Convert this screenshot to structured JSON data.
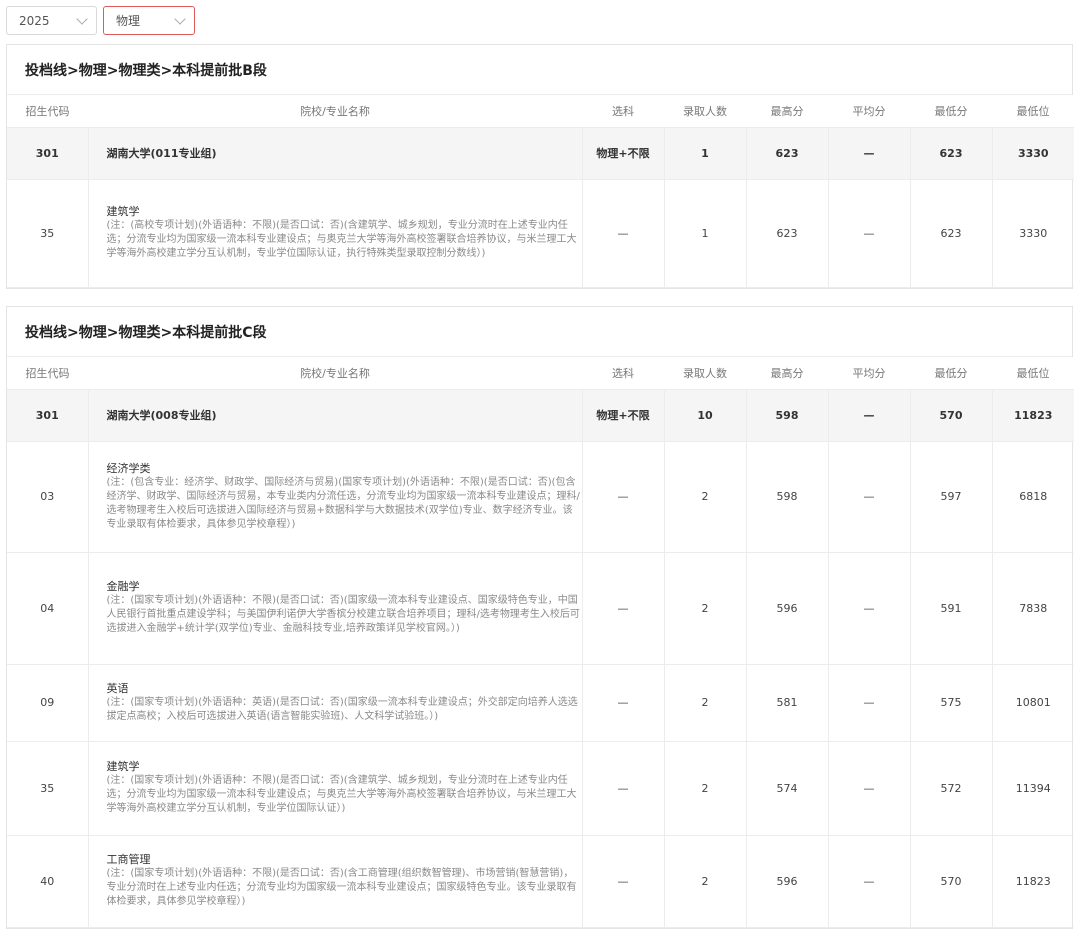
{
  "filters": {
    "year": "2025",
    "subject": "物理"
  },
  "headers": [
    "招生代码",
    "院校/专业名称",
    "选科",
    "录取人数",
    "最高分",
    "平均分",
    "最低分",
    "最低位"
  ],
  "sections": [
    {
      "title": "投档线>物理>物理类>本科提前批B段",
      "group": {
        "code": "301",
        "name": "湖南大学(011专业组)",
        "subject": "物理+不限",
        "count": "1",
        "max": "623",
        "avg": "—",
        "min": "623",
        "rank": "3330"
      },
      "majors": [
        {
          "code": "35",
          "name": "建筑学",
          "note": "(注：(高校专项计划)(外语语种：不限)(是否口试：否)(含建筑学、城乡规划，专业分流时在上述专业内任选；分流专业均为国家级一流本科专业建设点；与奥克兰大学等海外高校签署联合培养协议，与米兰理工大学等海外高校建立学分互认机制，专业学位国际认证，执行特殊类型录取控制分数线）)",
          "subject": "—",
          "count": "1",
          "max": "623",
          "avg": "—",
          "min": "623",
          "rank": "3330"
        }
      ]
    },
    {
      "title": "投档线>物理>物理类>本科提前批C段",
      "group": {
        "code": "301",
        "name": "湖南大学(008专业组)",
        "subject": "物理+不限",
        "count": "10",
        "max": "598",
        "avg": "—",
        "min": "570",
        "rank": "11823"
      },
      "majors": [
        {
          "code": "03",
          "name": "经济学类",
          "note": "(注：(包含专业：经济学、财政学、国际经济与贸易)(国家专项计划)(外语语种：不限)(是否口试：否)(包含经济学、财政学、国际经济与贸易，本专业类内分流任选，分流专业均为国家级一流本科专业建设点；理科/选考物理考生入校后可选拔进入国际经济与贸易+数据科学与大数据技术(双学位)专业、数字经济专业。该专业录取有体检要求，具体参见学校章程）)",
          "subject": "—",
          "count": "2",
          "max": "598",
          "avg": "—",
          "min": "597",
          "rank": "6818"
        },
        {
          "code": "04",
          "name": "金融学",
          "note": "(注：(国家专项计划)(外语语种：不限)(是否口试：否)(国家级一流本科专业建设点、国家级特色专业，中国人民银行首批重点建设学科；与美国伊利诺伊大学香槟分校建立联合培养项目；理科/选考物理考生入校后可选拔进入金融学+统计学(双学位)专业、金融科技专业,培养政策详见学校官网。）)",
          "subject": "—",
          "count": "2",
          "max": "596",
          "avg": "—",
          "min": "591",
          "rank": "7838"
        },
        {
          "code": "09",
          "name": "英语",
          "note": "(注：(国家专项计划)(外语语种：英语)(是否口试：否)(国家级一流本科专业建设点；外交部定向培养人选选拔定点高校；入校后可选拔进入英语(语言智能实验班)、人文科学试验班。）)",
          "subject": "—",
          "count": "2",
          "max": "581",
          "avg": "—",
          "min": "575",
          "rank": "10801"
        },
        {
          "code": "35",
          "name": "建筑学",
          "note": "(注：(国家专项计划)(外语语种：不限)(是否口试：否)(含建筑学、城乡规划，专业分流时在上述专业内任选；分流专业均为国家级一流本科专业建设点；与奥克兰大学等海外高校签署联合培养协议，与米兰理工大学等海外高校建立学分互认机制，专业学位国际认证）)",
          "subject": "—",
          "count": "2",
          "max": "574",
          "avg": "—",
          "min": "572",
          "rank": "11394"
        },
        {
          "code": "40",
          "name": "工商管理",
          "note": "(注：(国家专项计划)(外语语种：不限)(是否口试：否)(含工商管理(组织数智管理)、市场营销(智慧营销)，专业分流时在上述专业内任选；分流专业均为国家级一流本科专业建设点；国家级特色专业。该专业录取有体检要求，具体参见学校章程）)",
          "subject": "—",
          "count": "2",
          "max": "596",
          "avg": "—",
          "min": "570",
          "rank": "11823"
        }
      ]
    }
  ]
}
